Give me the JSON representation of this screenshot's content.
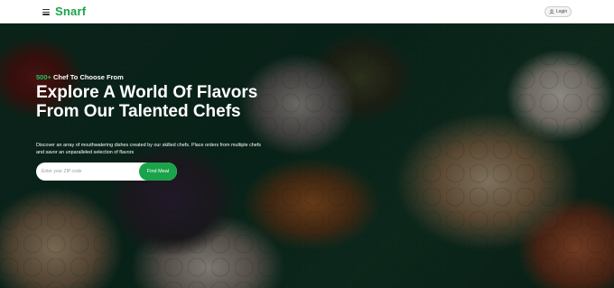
{
  "navbar": {
    "brand": "Snarf",
    "login_label": "Login"
  },
  "hero": {
    "tagline_count": "500+",
    "tagline_text": "Chef To Choose From",
    "headline_line1": "Explore A World Of Flavors",
    "headline_line2": "From Our Talented Chefs",
    "description": "Discover an array of mouthwatering dishes created by our skilled chefs. Place orders from multiple chefs and savor an unparalleled selection of flavors",
    "search_placeholder": "Enter your ZIP code",
    "search_value": "",
    "find_button_label": "Find Meal"
  },
  "colors": {
    "brand_green": "#1aa34a",
    "accent_green": "#22c35a",
    "navbar_bg": "#ffffff"
  },
  "icons": {
    "menu": "hamburger-menu-icon",
    "login": "user-icon"
  }
}
